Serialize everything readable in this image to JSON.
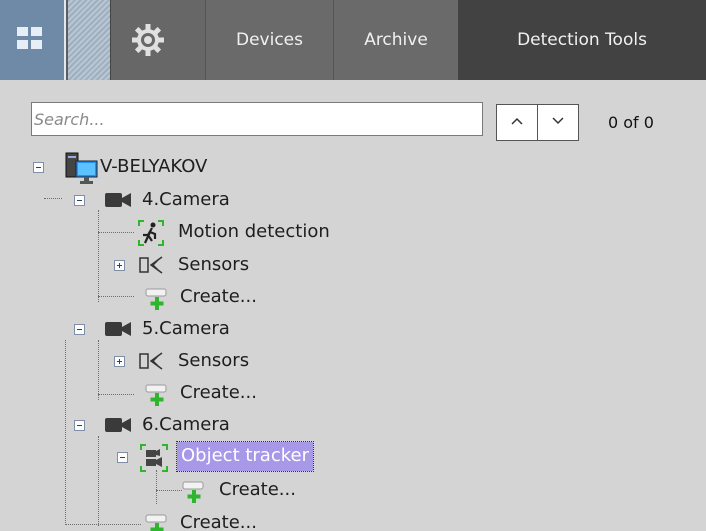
{
  "tabs": {
    "devices": "Devices",
    "archive": "Archive",
    "detection_tools": "Detection Tools"
  },
  "search": {
    "placeholder": "Search...",
    "value": "",
    "result_count": "0 of 0"
  },
  "tree": {
    "root": "V-BELYAKOV",
    "cam4": "4.Camera",
    "cam4_motion": "Motion detection",
    "cam4_sensors": "Sensors",
    "cam4_create": "Create...",
    "cam5": "5.Camera",
    "cam5_sensors": "Sensors",
    "cam5_create": "Create...",
    "cam6": "6.Camera",
    "cam6_tracker": "Object tracker",
    "cam6_tracker_create": "Create...",
    "cam6_create": "Create..."
  },
  "colors": {
    "selected_bg": "#a898e8",
    "camera_icon": "#3a3a3a",
    "create_plus": "#2db52d",
    "active_tab": "#424242"
  },
  "icons": [
    "layout-grid-icon",
    "gear-icon",
    "chevron-up-icon",
    "chevron-down-icon",
    "computer-server-icon",
    "camera-icon",
    "motion-detection-icon",
    "sensors-icon",
    "create-plus-icon",
    "object-tracker-icon"
  ]
}
